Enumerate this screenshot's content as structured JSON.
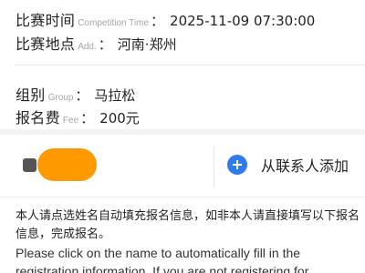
{
  "event": {
    "time_label_cn": "比赛时间",
    "time_label_en": "Competition Time",
    "time_value": "2025-11-09 07:30:00",
    "place_label_cn": "比赛地点",
    "place_label_en": "Add.",
    "place_value": "河南·郑州",
    "group_label_cn": "组别",
    "group_label_en": "Group",
    "group_value": "马拉松",
    "fee_label_cn": "报名费",
    "fee_label_en": "Fee",
    "fee_value": "200元",
    "colon": "："
  },
  "picker": {
    "add_contact_label": "从联系人添加",
    "chip_color": "#ff9900",
    "plus_icon": "plus-icon",
    "plus_color": "#2f7be8"
  },
  "notice": {
    "cn": "本人请点选姓名自动填充报名信息，如非本人请直接填写以下报名信息，完成报名。",
    "en": "Please click on the name to automatically fill in the registration information. If you are not registering for"
  }
}
